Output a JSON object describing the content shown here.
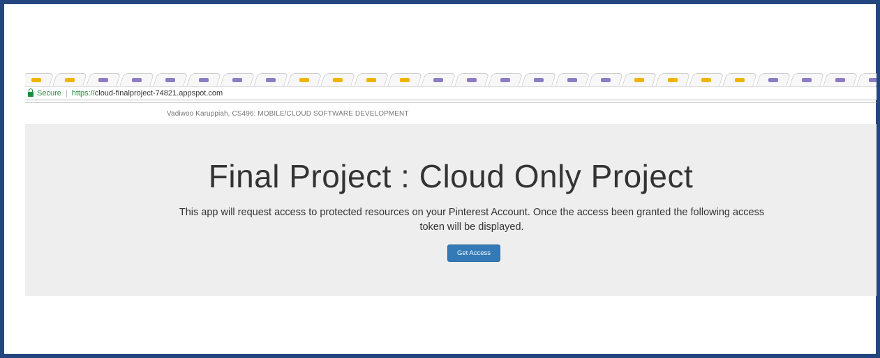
{
  "browser": {
    "security_label": "Secure",
    "separator": "|",
    "url_scheme": "https://",
    "url_host": "cloud-finalproject-74821.appspot.com",
    "tab_icon_colors": [
      "#f0b400",
      "#f0b400",
      "#8e7cc3",
      "#8e7cc3",
      "#8e7cc3",
      "#8e7cc3",
      "#8e7cc3",
      "#8e7cc3",
      "#f0b400",
      "#f0b400"
    ]
  },
  "page": {
    "author_line": "Vadiwoo Karuppiah, CS496: MOBILE/CLOUD SOFTWARE DEVELOPMENT",
    "title": "Final Project : Cloud Only Project",
    "description": "This app will request access to protected resources on your Pinterest Account. Once the access been granted the following access token will be displayed.",
    "button_label": "Get Access"
  },
  "colors": {
    "frame_border": "#23467f",
    "button_bg": "#337ab7",
    "jumbotron_bg": "#eeeeee",
    "secure_green": "#1e8e3e"
  }
}
